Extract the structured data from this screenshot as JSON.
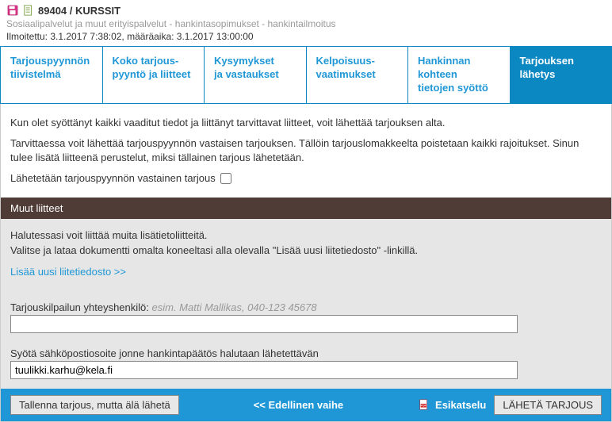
{
  "header": {
    "id_title": "89404 / KURSSIT",
    "subtitle": "Sosiaalipalvelut ja muut erityispalvelut - hankintasopimukset - hankintailmoitus",
    "dates": "Ilmoitettu: 3.1.2017 7:38:02, määräaika: 3.1.2017 13:00:00"
  },
  "tabs": [
    {
      "line1": "Tarjouspyynnön",
      "line2": "tiivistelmä"
    },
    {
      "line1": "Koko tarjous-",
      "line2": "pyyntö ja liitteet"
    },
    {
      "line1": "Kysymykset",
      "line2": "ja vastaukset"
    },
    {
      "line1": "Kelpoisuus-",
      "line2": "vaatimukset"
    },
    {
      "line1": "Hankinnan kohteen",
      "line2": "tietojen syöttö"
    },
    {
      "line1": "Tarjouksen",
      "line2": "lähetys"
    }
  ],
  "intro": {
    "p1": "Kun olet syöttänyt kaikki vaaditut tiedot ja liittänyt tarvittavat liitteet, voit lähettää tarjouksen alta.",
    "p2": "Tarvittaessa voit lähettää tarjouspyynnön vastaisen tarjouksen. Tällöin tarjouslomakkeelta poistetaan kaikki rajoitukset. Sinun tulee lisätä liitteenä perustelut, miksi tällainen tarjous lähetetään.",
    "cb_label": "Lähetetään tarjouspyynnön vastainen tarjous"
  },
  "attachments": {
    "title": "Muut liitteet",
    "p1": "Halutessasi voit liittää muita lisätietoliitteitä.",
    "p2": "Valitse ja lataa dokumentti omalta koneeltasi alla olevalla \"Lisää uusi liitetiedosto\" -linkillä.",
    "link": "Lisää uusi liitetiedosto >>"
  },
  "form": {
    "contact_label": "Tarjouskilpailun yhteyshenkilö:",
    "contact_hint": "esim. Matti Mallikas, 040-123 45678",
    "contact_value": "",
    "email_label": "Syötä sähköpostiosoite jonne hankintapäätös halutaan lähetettävän",
    "email_value": "tuulikki.karhu@kela.fi"
  },
  "footer": {
    "save": "Tallenna tarjous, mutta älä lähetä",
    "prev": "<< Edellinen vaihe",
    "preview": "Esikatselu",
    "send": "LÄHETÄ TARJOUS"
  }
}
